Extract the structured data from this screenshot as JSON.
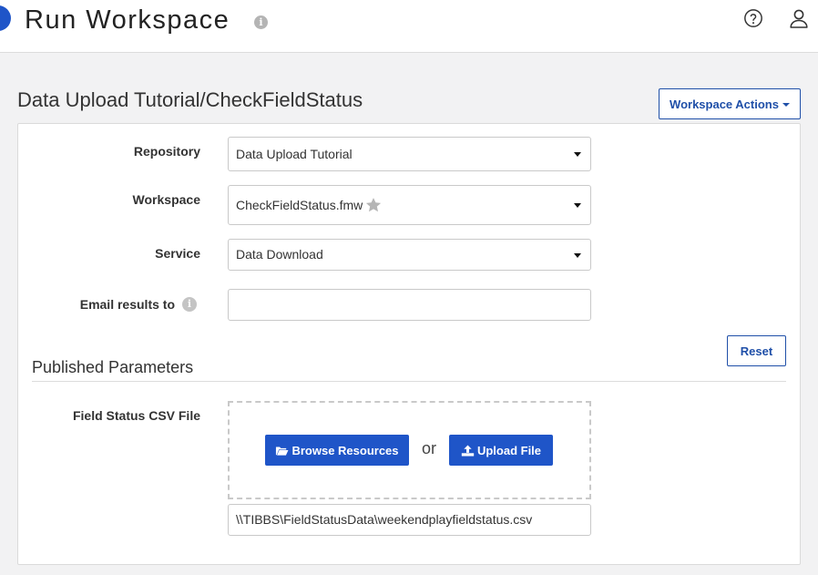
{
  "header": {
    "app_title": "Run Workspace",
    "info_icon": "info-icon",
    "help_icon": "help-circle-icon",
    "user_icon": "user-icon"
  },
  "page": {
    "heading": "Data Upload Tutorial/CheckFieldStatus",
    "workspace_actions_label": "Workspace Actions"
  },
  "form": {
    "repository": {
      "label": "Repository",
      "value": "Data Upload Tutorial"
    },
    "workspace": {
      "label": "Workspace",
      "value": "CheckFieldStatus.fmw",
      "favorite_icon": "star-icon"
    },
    "service": {
      "label": "Service",
      "value": "Data Download"
    },
    "email": {
      "label": "Email results to",
      "value": "",
      "info_icon": "info-icon"
    },
    "reset_label": "Reset"
  },
  "published_parameters": {
    "title": "Published Parameters",
    "field_status": {
      "label": "Field Status CSV File",
      "browse_label": "Browse Resources",
      "or_text": "or",
      "upload_label": "Upload File",
      "path_value": "\\\\TIBBS\\FieldStatusData\\weekendplayfieldstatus.csv"
    }
  },
  "colors": {
    "primary": "#1f55c8",
    "outline_button": "#1f4fa8",
    "background": "#f2f2f3"
  }
}
